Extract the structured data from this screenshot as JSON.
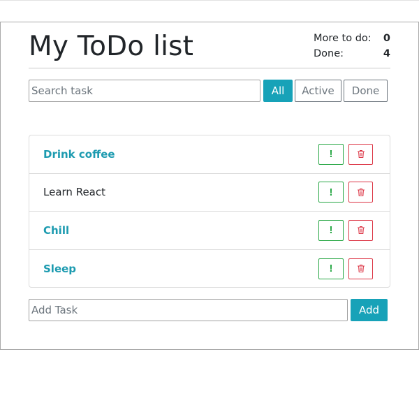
{
  "header": {
    "title": "My ToDo list",
    "more_to_do_label": "More to do:",
    "more_to_do_count": "0",
    "done_label": "Done:",
    "done_count": "4"
  },
  "search": {
    "placeholder": "Search task"
  },
  "filters": [
    {
      "label": "All",
      "active": true
    },
    {
      "label": "Active",
      "active": false
    },
    {
      "label": "Done",
      "active": false
    }
  ],
  "todos": [
    {
      "label": "Drink coffee",
      "important": true
    },
    {
      "label": "Learn React",
      "important": false
    },
    {
      "label": "Chill",
      "important": true
    },
    {
      "label": "Sleep",
      "important": true
    }
  ],
  "item_buttons": {
    "important_glyph": "!",
    "important_icon": "exclamation-icon",
    "delete_icon": "trash-icon"
  },
  "add": {
    "placeholder": "Add Task",
    "button_label": "Add"
  },
  "colors": {
    "accent": "#17a2b8",
    "important_text": "#1d9bb0",
    "important_border": "#28a745",
    "delete_border": "#dc3545"
  }
}
